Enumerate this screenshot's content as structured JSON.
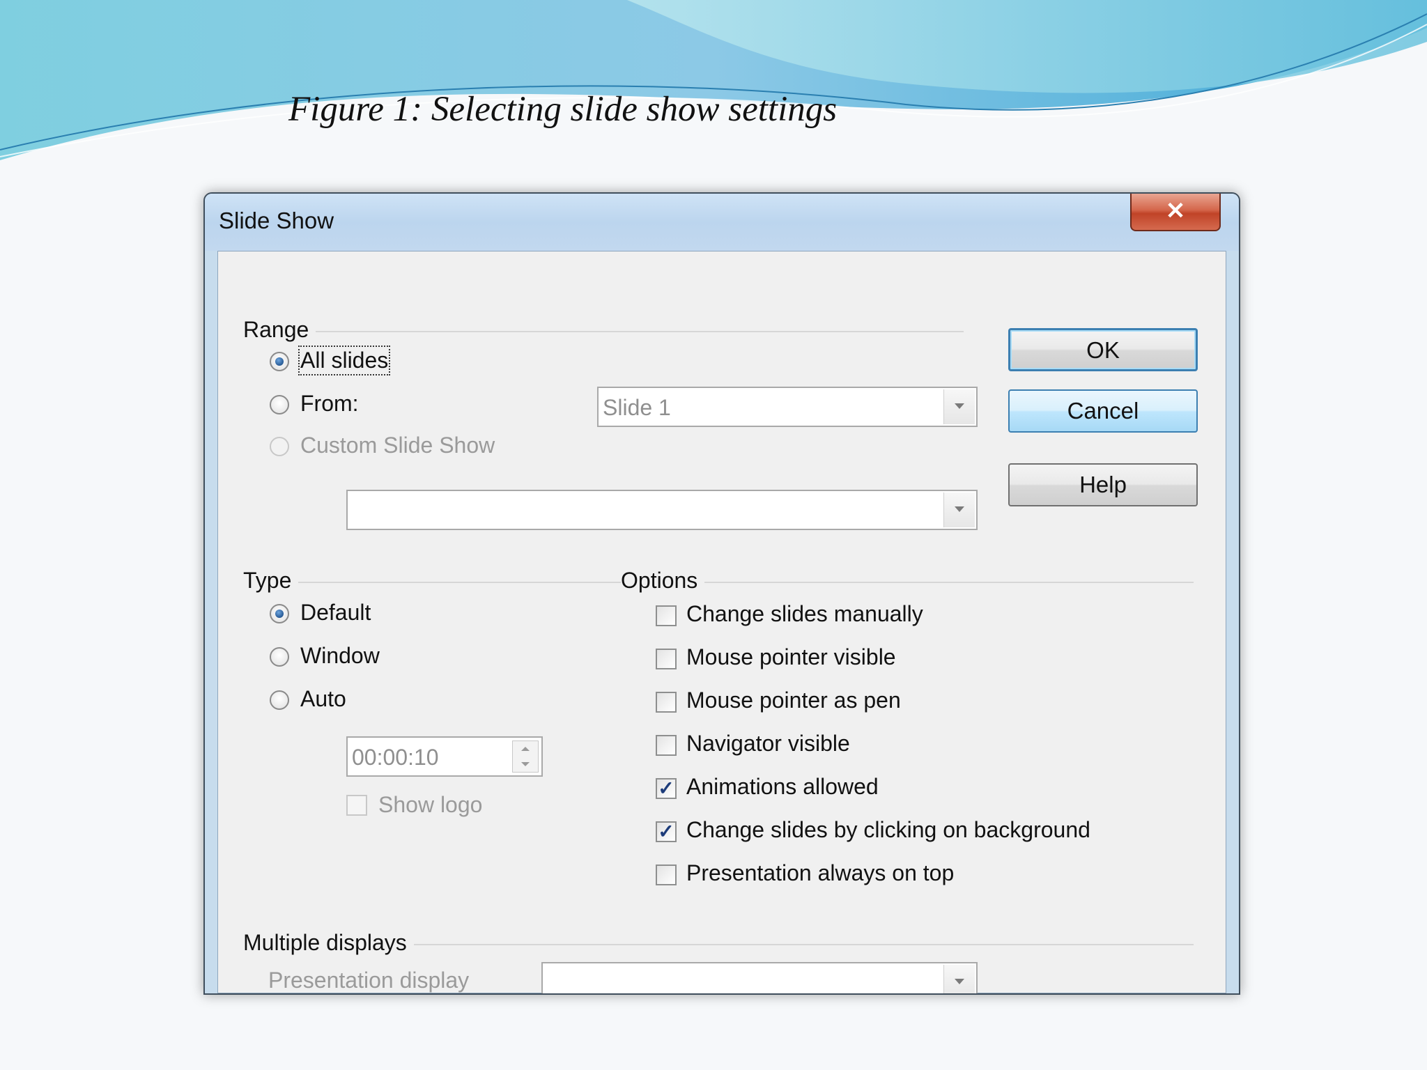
{
  "caption": "Figure 1: Selecting slide show settings",
  "dialog": {
    "title": "Slide Show",
    "close_glyph": "✕"
  },
  "range": {
    "label": "Range",
    "all_slides": "All slides",
    "from": "From:",
    "from_value": "Slide 1",
    "custom": "Custom Slide Show",
    "custom_value": ""
  },
  "buttons": {
    "ok": "OK",
    "cancel": "Cancel",
    "help": "Help"
  },
  "type": {
    "label": "Type",
    "default": "Default",
    "window": "Window",
    "auto": "Auto",
    "auto_time": "00:00:10",
    "show_logo": "Show logo"
  },
  "options": {
    "label": "Options",
    "items": [
      {
        "label": "Change slides manually",
        "checked": false
      },
      {
        "label": "Mouse pointer visible",
        "checked": false
      },
      {
        "label": "Mouse pointer as pen",
        "checked": false
      },
      {
        "label": "Navigator visible",
        "checked": false
      },
      {
        "label": "Animations allowed",
        "checked": true
      },
      {
        "label": "Change slides by clicking on background",
        "checked": true
      },
      {
        "label": "Presentation always on top",
        "checked": false
      }
    ],
    "check_glyph": "✓"
  },
  "displays": {
    "label": "Multiple displays",
    "presentation_display": "Presentation display",
    "presentation_display_value": ""
  },
  "colors": {
    "accent": "#3c7fb1",
    "close": "#c04327"
  }
}
